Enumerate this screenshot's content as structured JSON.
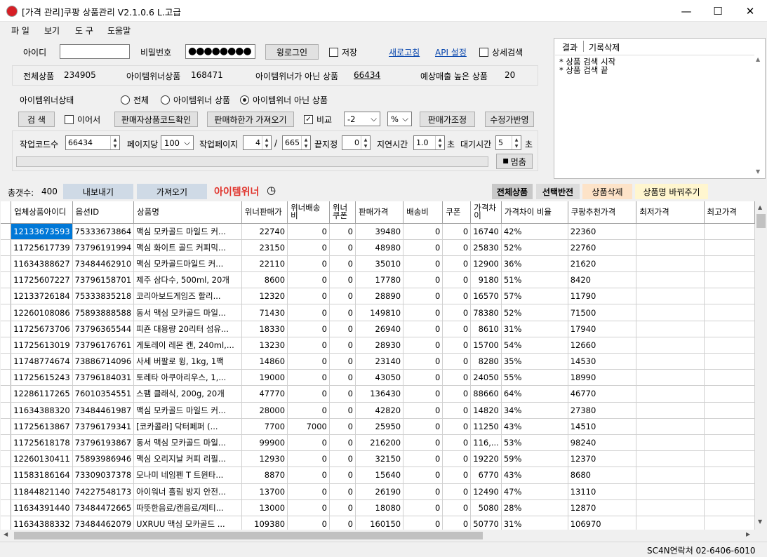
{
  "window": {
    "title": "[가격 관리]쿠팡 상품관리 V2.1.0.6 L.고급",
    "minimize": "—",
    "maximize": "☐",
    "close": "✕"
  },
  "menu": [
    "파 일",
    "보기",
    "도 구",
    "도움말"
  ],
  "login": {
    "id_label": "아이디",
    "id_value": "",
    "pw_label": "비밀번호",
    "pw_value": "●●●●●●●●",
    "login_button": "윙로그인",
    "save_label": "저장",
    "refresh_link": "새로고침",
    "api_link": "API 설정",
    "detail_search_label": "상세검색"
  },
  "stats": {
    "total_label": "전체상품",
    "total_value": "234905",
    "winner_label": "아이템위너상품",
    "winner_value": "168471",
    "nonwinner_label": "아이템위너가 아닌 상품",
    "nonwinner_value": "66434",
    "expected_label": "예상매출 높은 상품",
    "expected_value": "20"
  },
  "winner_status": {
    "label": "아이템위너상태",
    "options": [
      "전체",
      "아이템위너 상품",
      "아이템위너 아닌 상품"
    ],
    "selected": 2
  },
  "actions": {
    "search": "검 색",
    "continue": "이어서",
    "seller_code": "판매자상품코드확인",
    "lower_price": "판매하한가 가져오기",
    "compare": "비교",
    "compare_value": "-2",
    "unit": "%",
    "adjust_price": "판매가조정",
    "apply_price": "수정가반영"
  },
  "work": {
    "code_count_label": "작업코드수",
    "code_count": "66434",
    "per_page_label": "페이지당",
    "per_page": "100",
    "work_page_label": "작업페이지",
    "work_page": "4",
    "slash": "/",
    "total_pages": "665",
    "end_label": "끝지정",
    "end_value": "0",
    "delay_label": "지연시간",
    "delay_value": "1.0",
    "delay_unit": "초",
    "wait_label": "대기시간",
    "wait_value": "5",
    "wait_unit": "초",
    "stop_button": "멈춤"
  },
  "result_panel": {
    "tabs": [
      "결과",
      "기록삭제"
    ],
    "log": [
      "* 상품 검색 시작",
      "* 상품 검색 끝"
    ]
  },
  "toolbar": {
    "count_label": "총갯수:",
    "count_value": "400",
    "export": "내보내기",
    "import": "가져오기",
    "logo": "아이템위너",
    "clock_icon": "◷",
    "select_all": "전체상품",
    "invert": "선택반전",
    "delete": "상품삭제",
    "rename": "상품명 바꿔주기"
  },
  "table": {
    "headers": [
      "업체상품아이디",
      "옵션ID",
      "상품명",
      "위너판매가",
      "위너배송비",
      "위너쿠폰",
      "판매가격",
      "배송비",
      "쿠폰",
      "가격차이",
      "가격차이 비율",
      "쿠팡추천가격",
      "최저가격",
      "최고가격"
    ],
    "rows": [
      [
        "12133673593",
        "75333673864",
        "맥심 모카골드 마일드 커...",
        "22740",
        "0",
        "0",
        "39480",
        "0",
        "0",
        "16740",
        "42%",
        "22360",
        "",
        ""
      ],
      [
        "11725617739",
        "73796191994",
        "맥심 화이트 골드 커피믹...",
        "23150",
        "0",
        "0",
        "48980",
        "0",
        "0",
        "25830",
        "52%",
        "22760",
        "",
        ""
      ],
      [
        "11634388627",
        "73484462910",
        "맥심 모카골드마일드 커...",
        "22110",
        "0",
        "0",
        "35010",
        "0",
        "0",
        "12900",
        "36%",
        "21620",
        "",
        ""
      ],
      [
        "11725607227",
        "73796158701",
        "제주 삼다수, 500ml, 20개",
        "8600",
        "0",
        "0",
        "17780",
        "0",
        "0",
        "9180",
        "51%",
        "8420",
        "",
        ""
      ],
      [
        "12133726184",
        "75333835218",
        "코리아보드게임즈 할리...",
        "12320",
        "0",
        "0",
        "28890",
        "0",
        "0",
        "16570",
        "57%",
        "11790",
        "",
        ""
      ],
      [
        "12260108086",
        "75893888588",
        "동서 맥심 모카골드 마일...",
        "71430",
        "0",
        "0",
        "149810",
        "0",
        "0",
        "78380",
        "52%",
        "71500",
        "",
        ""
      ],
      [
        "11725673706",
        "73796365544",
        "피죤 대용량 20리터 섬유...",
        "18330",
        "0",
        "0",
        "26940",
        "0",
        "0",
        "8610",
        "31%",
        "17940",
        "",
        ""
      ],
      [
        "11725613019",
        "73796176761",
        "게토레이 레몬 캔, 240ml,...",
        "13230",
        "0",
        "0",
        "28930",
        "0",
        "0",
        "15700",
        "54%",
        "12660",
        "",
        ""
      ],
      [
        "11748774674",
        "73886714096",
        "사세 버팔로 윙, 1kg, 1팩",
        "14860",
        "0",
        "0",
        "23140",
        "0",
        "0",
        "8280",
        "35%",
        "14530",
        "",
        ""
      ],
      [
        "11725615243",
        "73796184031",
        "토레타 아쿠아리우스, 1,...",
        "19000",
        "0",
        "0",
        "43050",
        "0",
        "0",
        "24050",
        "55%",
        "18990",
        "",
        ""
      ],
      [
        "12286117265",
        "76010354551",
        "스팸 클래식, 200g, 20개",
        "47770",
        "0",
        "0",
        "136430",
        "0",
        "0",
        "88660",
        "64%",
        "46770",
        "",
        ""
      ],
      [
        "11634388320",
        "73484461987",
        "맥심 모카골드 마일드 커...",
        "28000",
        "0",
        "0",
        "42820",
        "0",
        "0",
        "14820",
        "34%",
        "27380",
        "",
        ""
      ],
      [
        "11725613867",
        "73796179341",
        "[코카콜라] 닥터페퍼 (...",
        "7700",
        "7000",
        "0",
        "25950",
        "0",
        "0",
        "11250",
        "43%",
        "14510",
        "",
        ""
      ],
      [
        "11725618178",
        "73796193867",
        "동서 맥심 모카골드 마일...",
        "99900",
        "0",
        "0",
        "216200",
        "0",
        "0",
        "116,...",
        "53%",
        "98240",
        "",
        ""
      ],
      [
        "12260130411",
        "75893986946",
        "맥심 오리지날 커피 리필...",
        "12930",
        "0",
        "0",
        "32150",
        "0",
        "0",
        "19220",
        "59%",
        "12370",
        "",
        ""
      ],
      [
        "11583186164",
        "73309037378",
        "모나미 네임펜 T 트윈타...",
        "8870",
        "0",
        "0",
        "15640",
        "0",
        "0",
        "6770",
        "43%",
        "8680",
        "",
        ""
      ],
      [
        "11844821140",
        "74227548173",
        "아이워너 흘림 방지 안전...",
        "13700",
        "0",
        "0",
        "26190",
        "0",
        "0",
        "12490",
        "47%",
        "13110",
        "",
        ""
      ],
      [
        "11634391440",
        "73484472665",
        "따뜻한음료/캔음료/제티...",
        "13000",
        "0",
        "0",
        "18080",
        "0",
        "0",
        "5080",
        "28%",
        "12870",
        "",
        ""
      ],
      [
        "11634388332",
        "73484462079",
        "UXRUU 맥심 모카골드 ...",
        "109380",
        "0",
        "0",
        "160150",
        "0",
        "0",
        "50770",
        "31%",
        "106970",
        "",
        ""
      ]
    ]
  },
  "status": {
    "contact": "SC4N연락처 02-6406-6010"
  },
  "colors": {
    "selection": "#0078d7",
    "link": "#0645ad",
    "logo": "#e0342c",
    "delete_bg": "#fde3c8",
    "rename_bg": "#fff6cf"
  }
}
